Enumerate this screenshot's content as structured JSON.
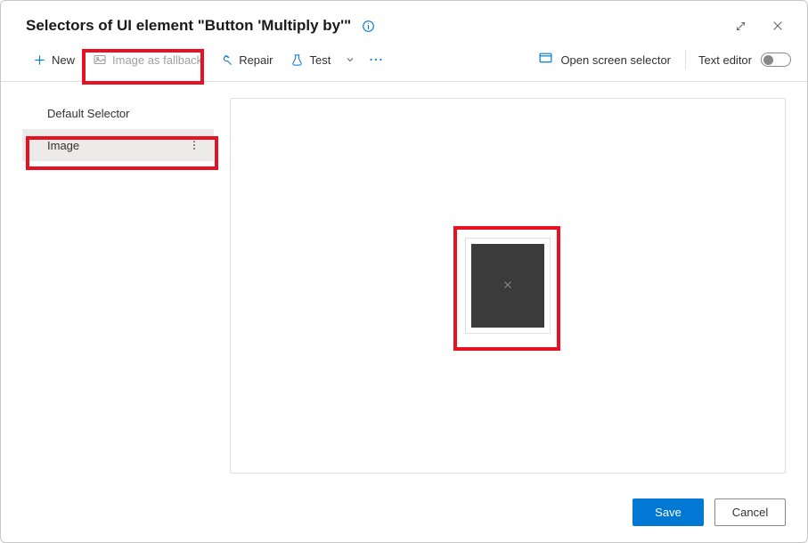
{
  "header": {
    "title": "Selectors of UI element \"Button 'Multiply by'\""
  },
  "toolbar": {
    "new_label": "New",
    "image_fallback_label": "Image as fallback",
    "repair_label": "Repair",
    "test_label": "Test",
    "open_screen_selector_label": "Open screen selector",
    "text_editor_label": "Text editor"
  },
  "sidebar": {
    "items": [
      {
        "label": "Default Selector"
      },
      {
        "label": "Image"
      }
    ]
  },
  "footer": {
    "save_label": "Save",
    "cancel_label": "Cancel"
  }
}
